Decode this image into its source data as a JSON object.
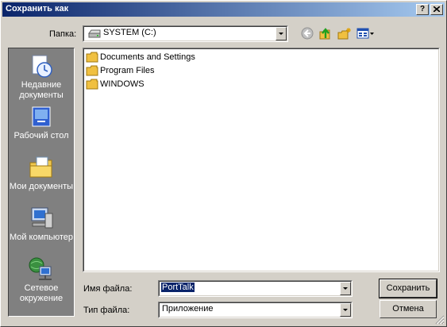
{
  "window": {
    "title": "Сохранить как",
    "help_label": "?",
    "close_label": "✕"
  },
  "toolbar": {
    "folder_label": "Папка:",
    "folder_value": "SYSTEM (C:)",
    "icons": [
      "back-icon",
      "up-folder-icon",
      "new-folder-icon",
      "view-menu-icon"
    ]
  },
  "places": [
    {
      "label": "Недавние документы",
      "icon": "recent-documents-icon"
    },
    {
      "label": "Рабочий стол",
      "icon": "desktop-icon"
    },
    {
      "label": "Мои документы",
      "icon": "my-documents-icon"
    },
    {
      "label": "Мой компьютер",
      "icon": "my-computer-icon"
    },
    {
      "label": "Сетевое окружение",
      "icon": "network-icon"
    }
  ],
  "files": [
    {
      "name": "Documents and Settings"
    },
    {
      "name": "Program Files"
    },
    {
      "name": "WINDOWS"
    }
  ],
  "form": {
    "filename_label": "Имя файла:",
    "filename_value": "PortTalk",
    "filetype_label": "Тип файла:",
    "filetype_value": "Приложение"
  },
  "buttons": {
    "save": "Сохранить",
    "cancel": "Отмена"
  },
  "colors": {
    "titlebar": "#0a246a",
    "face": "#d4d0c8",
    "places_bg": "#808080"
  }
}
